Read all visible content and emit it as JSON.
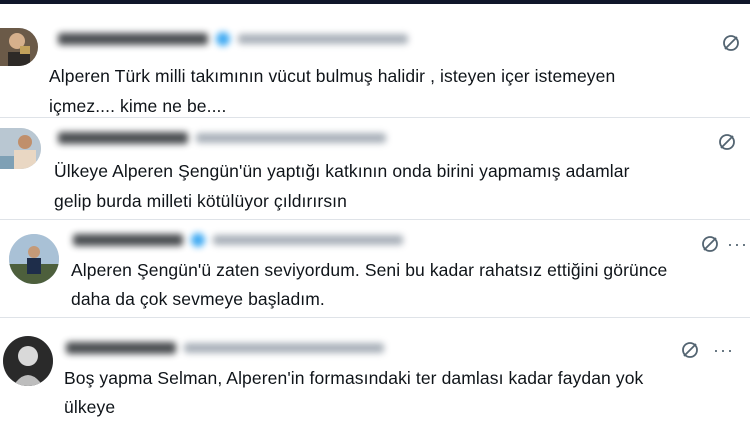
{
  "posts": [
    {
      "text_line1": "Alperen Türk milli takımının vücut bulmuş halidir , isteyen içer istemeyen",
      "text_line2": "içmez.... kime ne be....",
      "has_verified_badge": true,
      "has_more_menu": false,
      "action_icon": "grok-icon"
    },
    {
      "text_line1": "Ülkeye Alperen Şengün'ün yaptığı katkının onda birini yapmamış adamlar",
      "text_line2": "gelip burda milleti kötülüyor çıldırırsın",
      "has_verified_badge": false,
      "has_more_menu": false,
      "action_icon": "grok-icon"
    },
    {
      "text_line1": "Alperen Şengün'ü zaten seviyordum. Seni bu kadar rahatsız ettiğini görünce",
      "text_line2": "daha da çok sevmeye başladım.",
      "has_verified_badge": true,
      "has_more_menu": true,
      "action_icon": "grok-icon"
    },
    {
      "text_line1": "Boş yapma Selman, Alperen'in formasındaki ter damlası kadar faydan yok",
      "text_line2": "ülkeye",
      "has_verified_badge": false,
      "has_more_menu": true,
      "action_icon": "grok-icon"
    }
  ],
  "ui": {
    "more_glyph": "···",
    "text_color": "#0f1419",
    "icon_color": "#536471",
    "verified_color": "#1d9bf0"
  }
}
